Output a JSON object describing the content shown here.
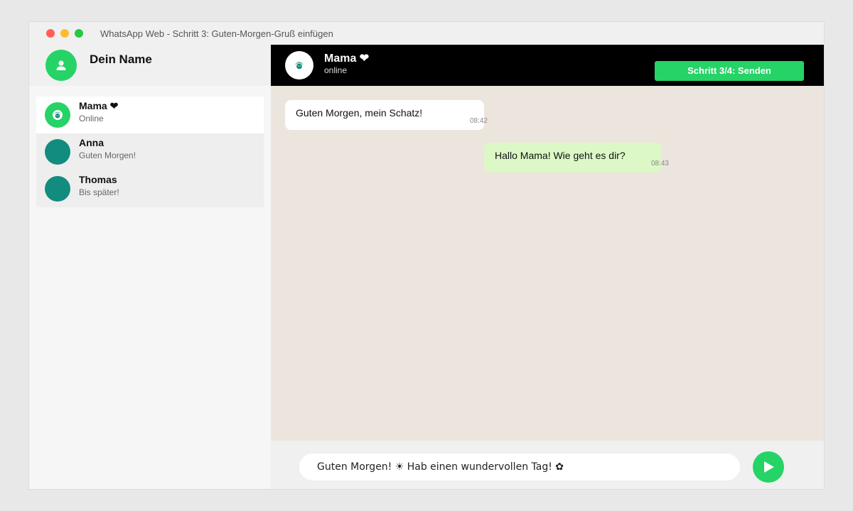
{
  "window": {
    "title": "WhatsApp Web - Schritt 3: Guten-Morgen-Gruß einfügen"
  },
  "sidebar": {
    "profile_name": "Dein Name",
    "chats": [
      {
        "name": "Mama ❤",
        "preview": "Online",
        "active": true
      },
      {
        "name": "Anna",
        "preview": "Guten Morgen!",
        "active": false
      },
      {
        "name": "Thomas",
        "preview": "Bis später!",
        "active": false
      }
    ]
  },
  "chat": {
    "contact_name": "Mama ❤",
    "contact_status": "online",
    "step_button_label": "Schritt 3/4: Senden",
    "messages": [
      {
        "direction": "in",
        "text": "Guten Morgen, mein Schatz!",
        "time": "08:42"
      },
      {
        "direction": "out",
        "text": "Hallo Mama! Wie geht es dir?",
        "time": "08:43"
      }
    ],
    "composer_value": "Guten Morgen! ☀ Hab einen wundervollen Tag! ✿"
  },
  "colors": {
    "accent": "#25d366",
    "header_bg": "#000000",
    "chat_bg": "#ece5dd",
    "outgoing_bubble": "#dcf8c6",
    "avatar_teal": "#128c7e"
  },
  "icons": {
    "profile": "user-icon",
    "mama_avatar": "face-icon",
    "send": "play-send-icon"
  }
}
